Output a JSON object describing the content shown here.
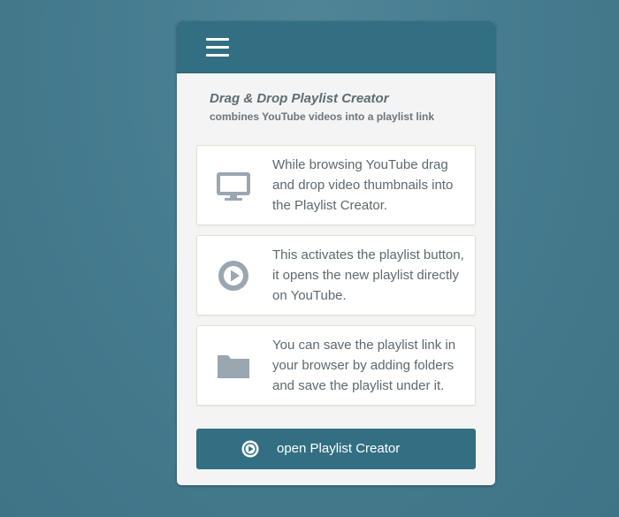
{
  "colors": {
    "header": "#326f82",
    "button": "#326f82",
    "icon": "#9aa6b0",
    "text": "#5d6870",
    "background": "#467c8f"
  },
  "header": {
    "menu_icon": "hamburger-menu-icon"
  },
  "intro": {
    "title": "Drag & Drop Playlist Creator",
    "subtitle": "combines YouTube videos into a playlist link"
  },
  "features": [
    {
      "icon": "monitor-icon",
      "text": "While browsing YouTube drag and drop video thumbnails into the Playlist Creator."
    },
    {
      "icon": "play-circle-icon",
      "text": "This activates the playlist button, it opens the new playlist directly on YouTube."
    },
    {
      "icon": "folder-icon",
      "text": "You can save the playlist link in your browser by adding folders and save the playlist under it."
    }
  ],
  "open_button": {
    "icon": "play-circle-icon",
    "label": "open Playlist Creator"
  }
}
